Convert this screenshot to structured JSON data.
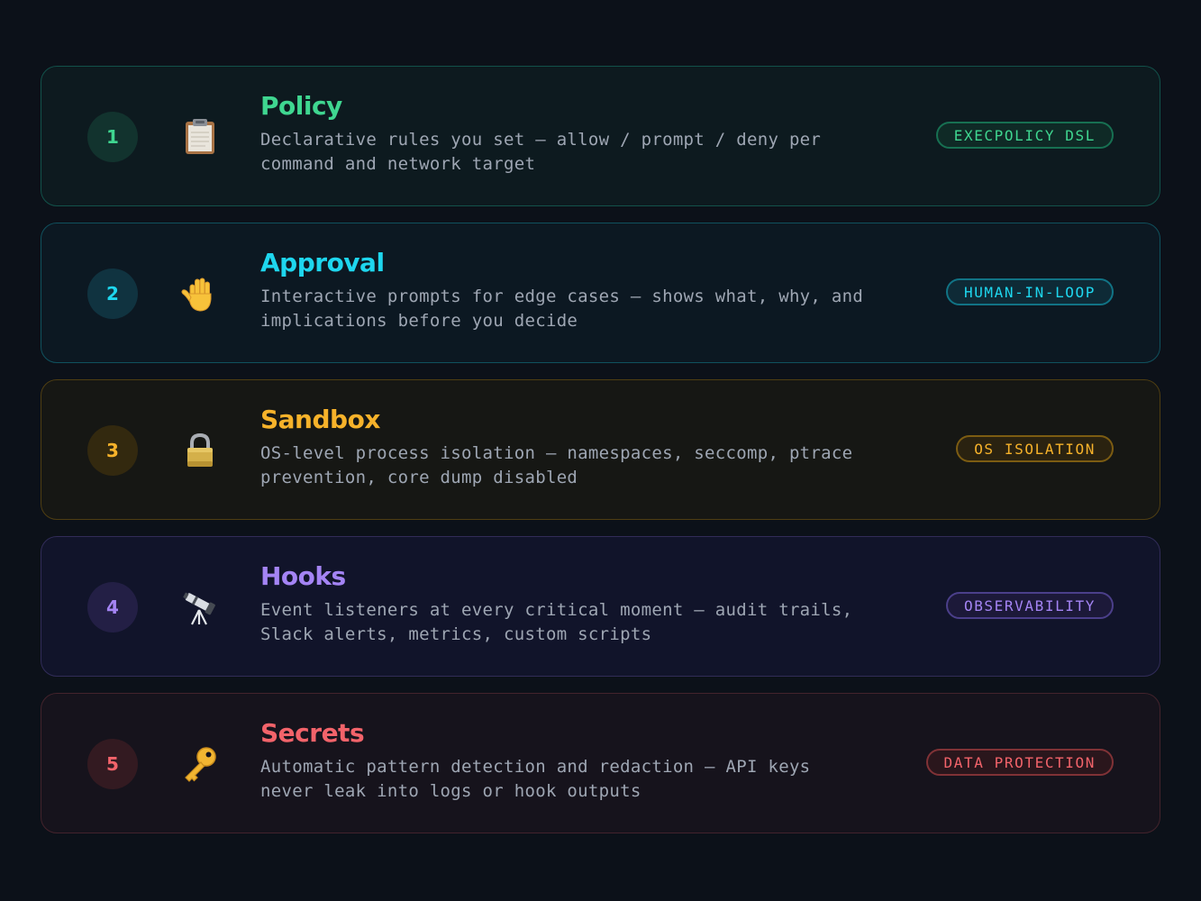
{
  "layers": [
    {
      "number": "1",
      "icon": "clipboard-icon",
      "title": "Policy",
      "description": "Declarative rules you set — allow / prompt / deny per\ncommand and network target",
      "badge": "EXECPOLICY DSL",
      "accent": "#3fd690"
    },
    {
      "number": "2",
      "icon": "raised-hand-icon",
      "title": "Approval",
      "description": "Interactive prompts for edge cases — shows what, why, and\nimplications before you decide",
      "badge": "HUMAN-IN-LOOP",
      "accent": "#1ed6ee"
    },
    {
      "number": "3",
      "icon": "padlock-icon",
      "title": "Sandbox",
      "description": "OS-level process isolation — namespaces, seccomp, ptrace\nprevention, core dump disabled",
      "badge": "OS ISOLATION",
      "accent": "#f6b22a"
    },
    {
      "number": "4",
      "icon": "telescope-icon",
      "title": "Hooks",
      "description": "Event listeners at every critical moment — audit trails,\nSlack alerts, metrics, custom scripts",
      "badge": "OBSERVABILITY",
      "accent": "#a484f4"
    },
    {
      "number": "5",
      "icon": "key-icon",
      "title": "Secrets",
      "description": "Automatic pattern detection and redaction — API keys\nnever leak into logs or hook outputs",
      "badge": "DATA PROTECTION",
      "accent": "#f2636a"
    }
  ]
}
